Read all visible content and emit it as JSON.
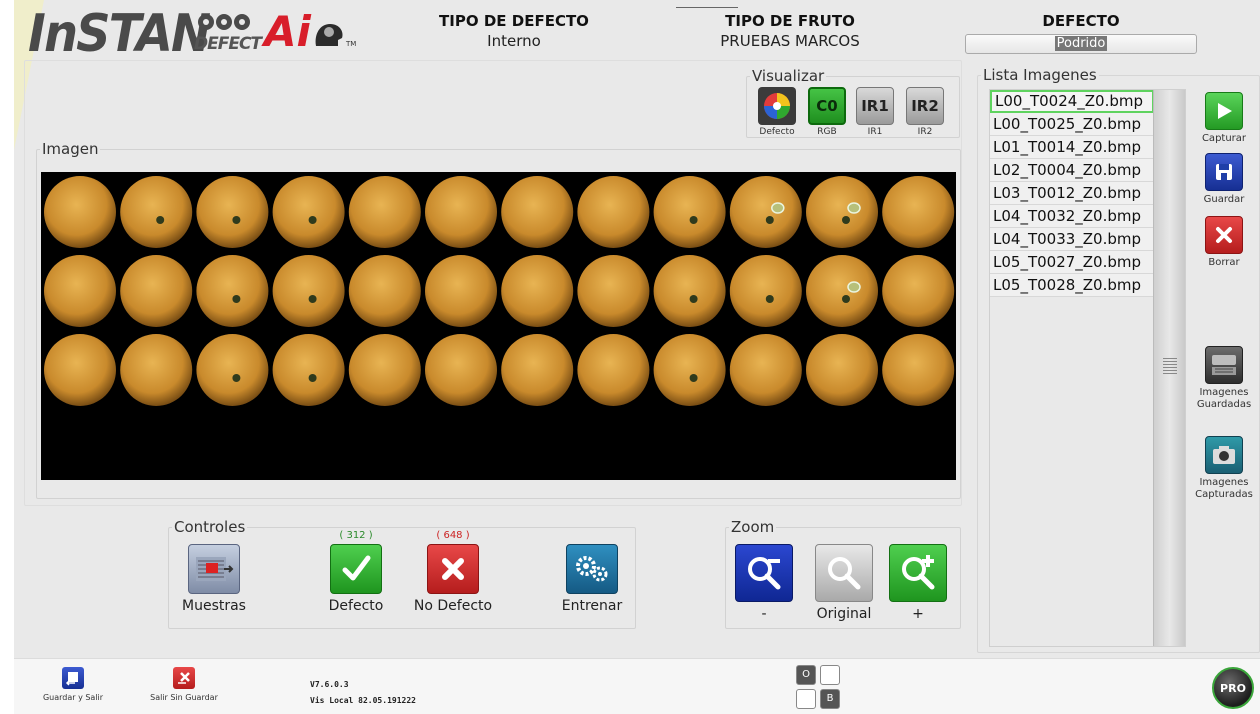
{
  "brand": {
    "name": "InSTAN",
    "sub": "DEFECT",
    "ai": "Ai",
    "tm": "TM"
  },
  "header": {
    "tipo_defecto_title": "TIPO DE DEFECTO",
    "tipo_defecto_value": "Interno",
    "tipo_fruto_title": "TIPO DE FRUTO",
    "tipo_fruto_value": "PRUEBAS MARCOS",
    "defecto_title": "DEFECTO",
    "defecto_value": "Podrido"
  },
  "visualizar": {
    "title": "Visualizar",
    "buttons": [
      {
        "icon": "C0",
        "label": "Defecto"
      },
      {
        "icon": "C0",
        "label": "RGB"
      },
      {
        "icon": "IR1",
        "label": "IR1"
      },
      {
        "icon": "IR2",
        "label": "IR2"
      }
    ]
  },
  "imagen": {
    "title": "Imagen",
    "grid_rows": 3,
    "grid_cols": 12
  },
  "lista": {
    "title": "Lista Imagenes",
    "items": [
      "L00_T0024_Z0.bmp",
      "L00_T0025_Z0.bmp",
      "L01_T0014_Z0.bmp",
      "L02_T0004_Z0.bmp",
      "L03_T0012_Z0.bmp",
      "L04_T0032_Z0.bmp",
      "L04_T0033_Z0.bmp",
      "L05_T0027_Z0.bmp",
      "L05_T0028_Z0.bmp"
    ],
    "selected_index": 0
  },
  "side": {
    "capturar": "Capturar",
    "guardar": "Guardar",
    "borrar": "Borrar",
    "imagenes_guardadas": "Imagenes Guardadas",
    "imagenes_capturadas": "Imagenes Capturadas"
  },
  "controles": {
    "title": "Controles",
    "muestras": "Muestras",
    "defecto": "Defecto",
    "defecto_count": "( 312 )",
    "no_defecto": "No Defecto",
    "no_defecto_count": "( 648 )",
    "entrenar": "Entrenar"
  },
  "zoom": {
    "title": "Zoom",
    "minus": "-",
    "original": "Original",
    "plus": "+"
  },
  "bottom": {
    "guardar_salir": "Guardar y Salir",
    "salir_sin_guardar": "Salir Sin Guardar",
    "version": "V7.6.0.3",
    "vis_local": "Vis Local 82.05.191222",
    "o_label": "O",
    "b_label": "B",
    "pro_label": "PRO"
  },
  "colors": {
    "green": "#2fa82f",
    "red": "#c8232b",
    "blue": "#1f3fa8",
    "list_selected_border": "#5fd35f"
  }
}
